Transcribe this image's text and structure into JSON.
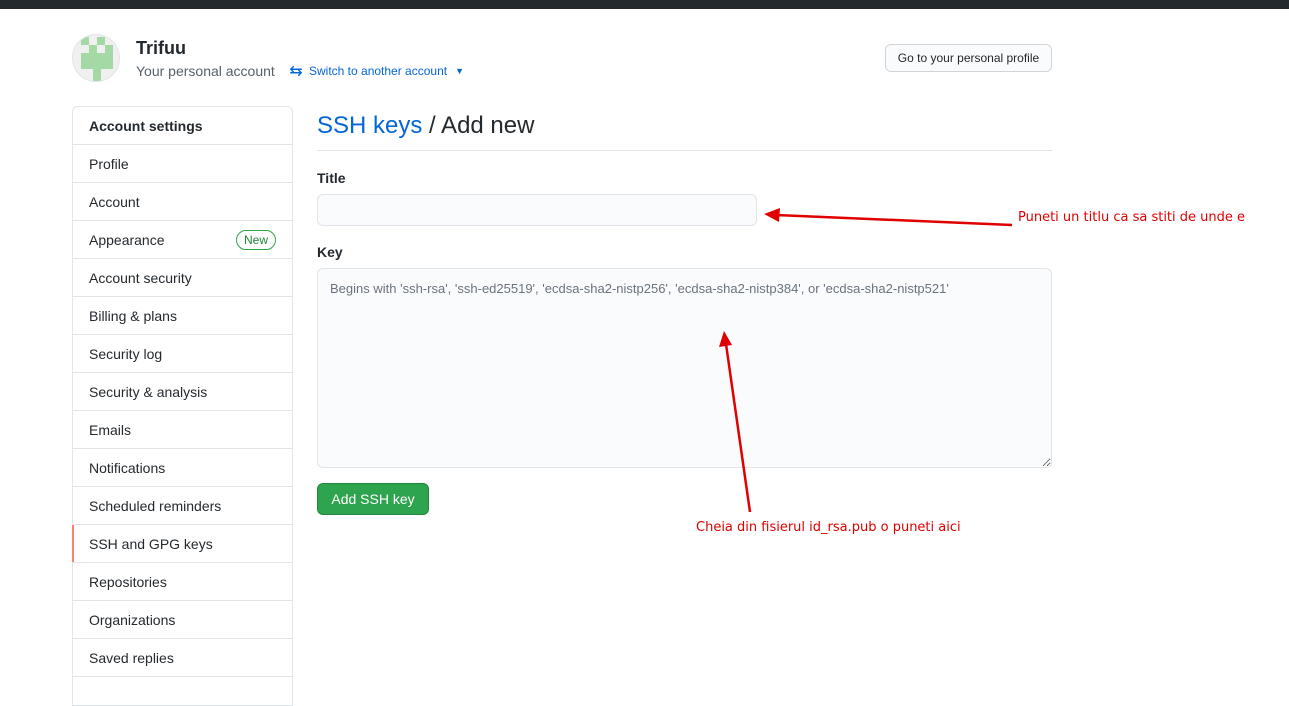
{
  "header": {
    "user_name": "Trifuu",
    "user_subtitle": "Your personal account",
    "switch_label": "Switch to another account",
    "profile_button": "Go to your personal profile"
  },
  "sidebar": {
    "heading": "Account settings",
    "items": [
      {
        "label": "Profile"
      },
      {
        "label": "Account"
      },
      {
        "label": "Appearance",
        "badge": "New"
      },
      {
        "label": "Account security"
      },
      {
        "label": "Billing & plans"
      },
      {
        "label": "Security log"
      },
      {
        "label": "Security & analysis"
      },
      {
        "label": "Emails"
      },
      {
        "label": "Notifications"
      },
      {
        "label": "Scheduled reminders"
      },
      {
        "label": "SSH and GPG keys",
        "selected": true
      },
      {
        "label": "Repositories"
      },
      {
        "label": "Organizations"
      },
      {
        "label": "Saved replies"
      }
    ]
  },
  "main": {
    "breadcrumb_link": "SSH keys",
    "breadcrumb_rest": " / Add new",
    "title_label": "Title",
    "title_value": "",
    "key_label": "Key",
    "key_placeholder": "Begins with 'ssh-rsa', 'ssh-ed25519', 'ecdsa-sha2-nistp256', 'ecdsa-sha2-nistp384', or 'ecdsa-sha2-nistp521'",
    "submit_label": "Add SSH key"
  },
  "annotations": {
    "title_note": "Puneti un titlu ca sa stiti de unde e",
    "key_note": "Cheia din fisierul id_rsa.pub o puneti aici"
  },
  "colors": {
    "link": "#0366d6",
    "primary_button": "#2ea44f",
    "annotation": "#e00000",
    "selected_marker": "#f9826c"
  },
  "icons": {
    "switch": "arrows-switch-icon",
    "caret": "caret-down-icon"
  }
}
